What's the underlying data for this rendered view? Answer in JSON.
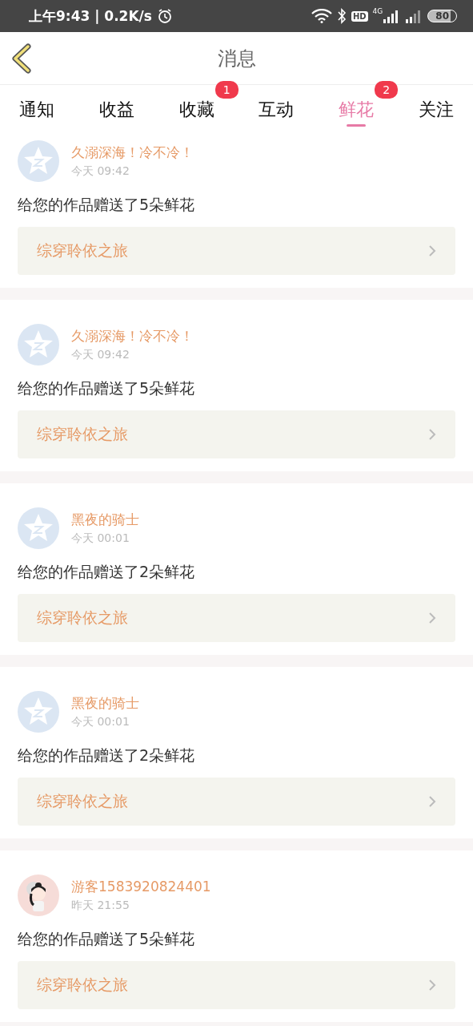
{
  "status_bar": {
    "time": "上午9:43 | 0.2K/s",
    "hd": "HD",
    "network": "4G",
    "battery": "80"
  },
  "header": {
    "title": "消息"
  },
  "tabs": [
    {
      "label": "通知",
      "selected": false
    },
    {
      "label": "收益",
      "selected": false
    },
    {
      "label": "收藏",
      "selected": false,
      "badge": "1"
    },
    {
      "label": "互动",
      "selected": false
    },
    {
      "label": "鲜花",
      "selected": true,
      "badge": "2"
    },
    {
      "label": "关注",
      "selected": false
    }
  ],
  "messages": [
    {
      "avatar": {
        "kind": "default"
      },
      "name": "久溺深海！冷不冷！",
      "time": "今天 09:42",
      "text": "给您的作品赠送了5朵鲜花",
      "book": "综穿聆依之旅"
    },
    {
      "avatar": {
        "kind": "default"
      },
      "name": "久溺深海！冷不冷！",
      "time": "今天 09:42",
      "text": "给您的作品赠送了5朵鲜花",
      "book": "综穿聆依之旅"
    },
    {
      "avatar": {
        "kind": "default"
      },
      "name": "黑夜的骑士",
      "time": "今天 00:01",
      "text": "给您的作品赠送了2朵鲜花",
      "book": "综穿聆依之旅"
    },
    {
      "avatar": {
        "kind": "default"
      },
      "name": "黑夜的骑士",
      "time": "今天 00:01",
      "text": "给您的作品赠送了2朵鲜花",
      "book": "综穿聆依之旅"
    },
    {
      "name": "游客1583920824401",
      "time": "昨天 21:55",
      "text": "给您的作品赠送了5朵鲜花",
      "book": "综穿聆依之旅"
    }
  ]
}
